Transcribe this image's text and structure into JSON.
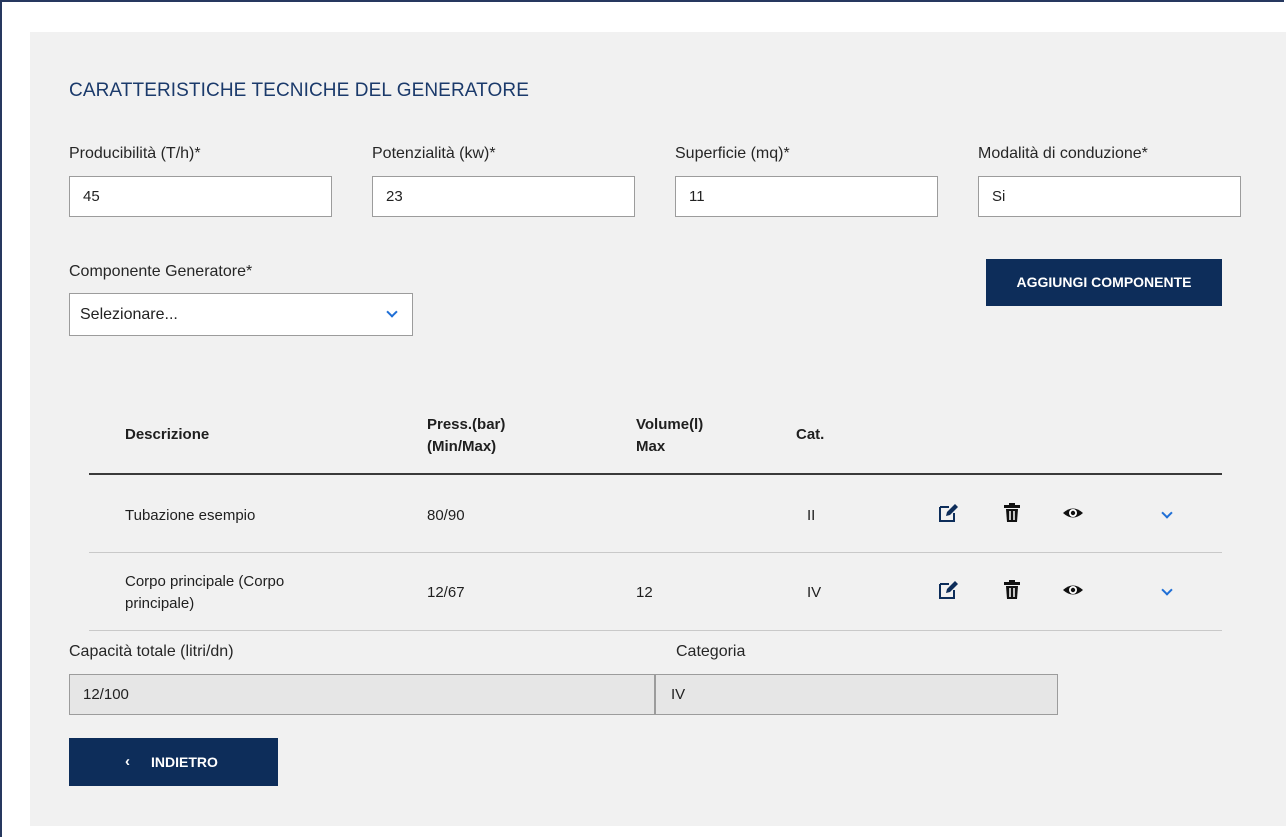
{
  "section_title": "CARATTERISTICHE TECNICHE DEL GENERATORE",
  "fields": {
    "producibilita": {
      "label": "Producibilità (T/h)*",
      "value": "45"
    },
    "potenzialita": {
      "label": "Potenzialità (kw)*",
      "value": "23"
    },
    "superficie": {
      "label": "Superficie (mq)*",
      "value": "11"
    },
    "modalita": {
      "label": "Modalità di conduzione*",
      "value": "Si"
    }
  },
  "componente": {
    "label": "Componente Generatore*",
    "selected": "Selezionare..."
  },
  "add_button": "AGGIUNGI COMPONENTE",
  "table": {
    "headers": {
      "descrizione": "Descrizione",
      "press_1": "Press.(bar)",
      "press_2": "(Min/Max)",
      "volume_1": "Volume(l)",
      "volume_2": "Max",
      "cat": "Cat."
    },
    "rows": [
      {
        "descrizione": "Tubazione esempio",
        "pressione": "80/90",
        "volume": "",
        "categoria": "II"
      },
      {
        "descrizione_1": "Corpo principale (Corpo",
        "descrizione_2": "principale)",
        "pressione": "12/67",
        "volume": "12",
        "categoria": "IV"
      }
    ],
    "row_icons": [
      "edit-icon",
      "trash-icon",
      "eye-icon",
      "chevron-down-icon"
    ]
  },
  "totals": {
    "capacita": {
      "label": "Capacità totale (litri/dn)",
      "value": "12/100"
    },
    "categoria": {
      "label": "Categoria",
      "value": "IV"
    }
  },
  "back_button": "INDIETRO",
  "back_icon": "chevron-left-icon",
  "colors": {
    "primary": "#0d2d5a",
    "title": "#1b3a6b",
    "accent": "#1f6fd6",
    "panel": "#f1f1f1"
  }
}
